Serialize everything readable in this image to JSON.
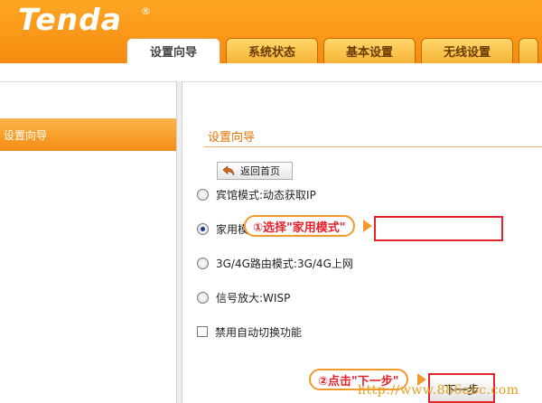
{
  "brand": {
    "logo_text": "Tenda",
    "reg_mark": "®"
  },
  "tabs": [
    {
      "label": "设置向导",
      "active": true
    },
    {
      "label": "系统状态",
      "active": false
    },
    {
      "label": "基本设置",
      "active": false
    },
    {
      "label": "无线设置",
      "active": false
    },
    {
      "label": "",
      "active": false
    }
  ],
  "sidebar": {
    "items": [
      {
        "label": "设置向导",
        "active": true
      }
    ]
  },
  "main": {
    "title": "设置向导",
    "back_button": "返回首页",
    "options": [
      {
        "label": "宾馆模式:动态获取IP",
        "checked": false
      },
      {
        "label": "家用模式:ADSL拨号",
        "checked": true
      },
      {
        "label": "3G/4G路由模式:3G/4G上网",
        "checked": false
      },
      {
        "label": "信号放大:WISP",
        "checked": false
      }
    ],
    "auto_switch_checkbox": {
      "label": "禁用自动切换功能",
      "checked": false
    },
    "next_button": "下一步"
  },
  "annotations": {
    "step1": "①选择\"家用模式\"",
    "step2": "②点击\"下一步\""
  },
  "watermark": "http://www.886abc.com",
  "colors": {
    "accent": "#f58b0f",
    "highlight": "#e4232b",
    "title": "#e87300"
  }
}
